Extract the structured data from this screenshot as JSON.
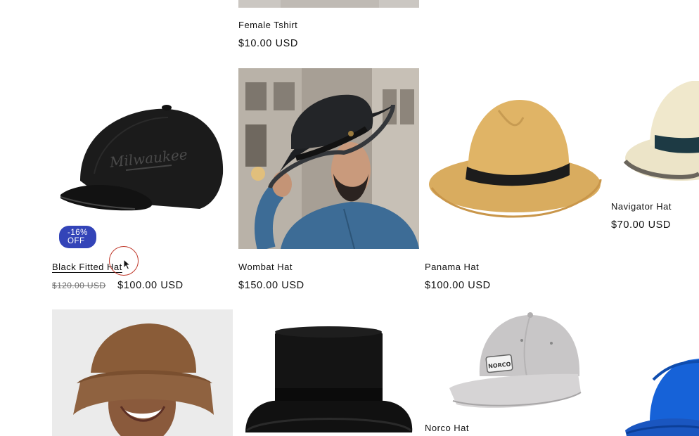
{
  "products": {
    "female_tshirt": {
      "title": "Female Tshirt",
      "price": "$10.00 USD"
    },
    "black_fitted_hat": {
      "title": "Black Fitted Hat",
      "badge": "-16% OFF",
      "compare_price": "$120.00 USD",
      "price": "$100.00 USD",
      "logo_text": "Milwaukee"
    },
    "wombat_hat": {
      "title": "Wombat Hat",
      "price": "$150.00 USD"
    },
    "panama_hat": {
      "title": "Panama Hat",
      "price": "$100.00 USD"
    },
    "navigator_hat": {
      "title": "Navigator Hat",
      "price": "$70.00 USD"
    },
    "bucket_hat": {},
    "top_hat": {},
    "norco_hat": {
      "title": "Norco Hat",
      "patch_text": "NORCO"
    },
    "blue_cap": {}
  },
  "colors": {
    "badge": "#3344b8",
    "cursor_ring": "#c0392b",
    "text": "#121212",
    "muted": "#6e6e6e"
  }
}
